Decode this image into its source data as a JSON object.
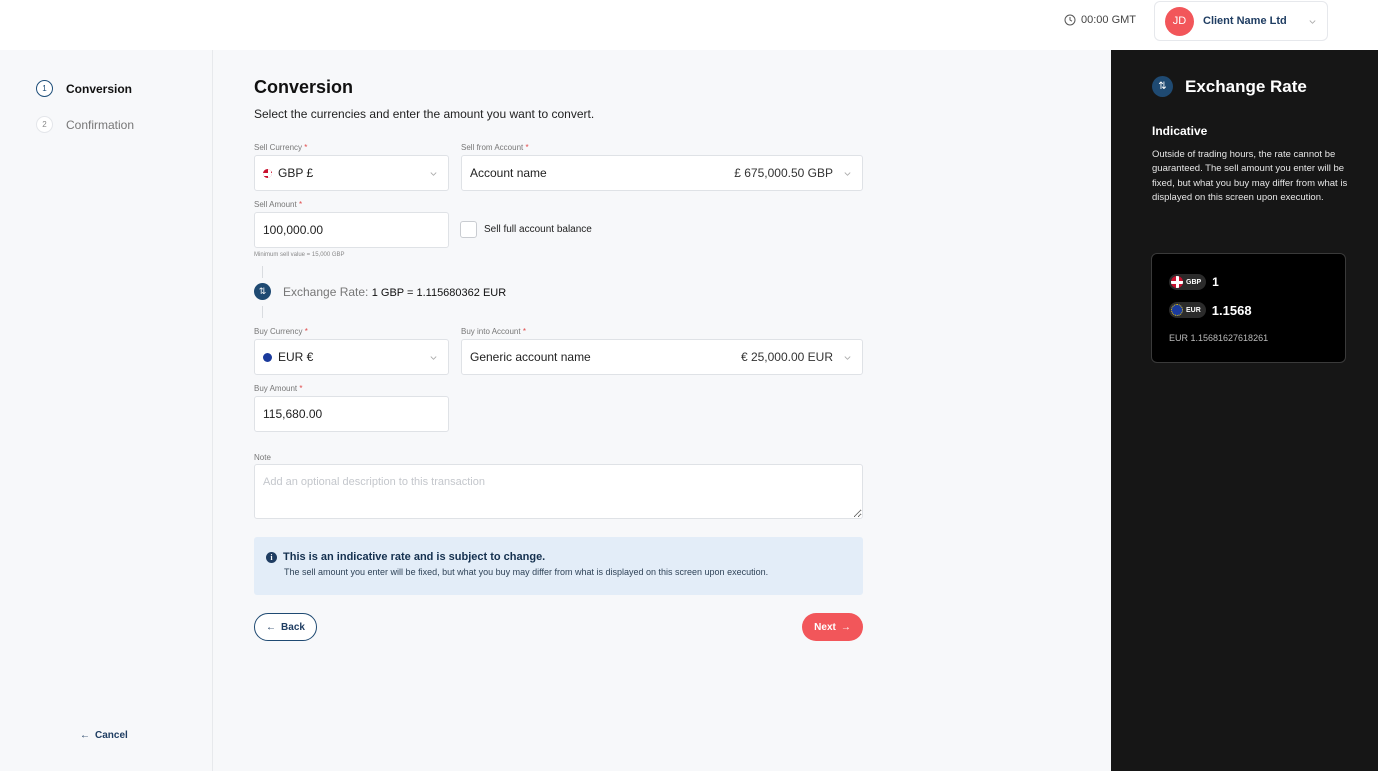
{
  "header": {
    "clock_icon": "clock-icon",
    "time": "00:00 GMT",
    "client": {
      "initials": "JD",
      "name": "Client Name Ltd",
      "avatar_color": "#f2565a"
    }
  },
  "steps": [
    {
      "number": "1",
      "label": "Conversion",
      "active": true
    },
    {
      "number": "2",
      "label": "Confirmation",
      "active": false
    }
  ],
  "cancel_label": "Cancel",
  "form": {
    "title": "Conversion",
    "subtitle": "Select the currencies and enter the amount you want to convert.",
    "sell_currency": {
      "label": "Sell Currency",
      "value": "GBP £"
    },
    "sell_account": {
      "label": "Sell from Account",
      "name": "Account name",
      "balance": "£ 675,000.50 GBP"
    },
    "sell_amount": {
      "label": "Sell Amount",
      "value": "100,000.00",
      "hint": "Minimum sell value = 15,000 GBP"
    },
    "sell_full_balance": {
      "label": "Sell full account balance",
      "checked": false
    },
    "exchange_rate": {
      "label": "Exchange Rate:",
      "value": "1 GBP = 1.115680362 EUR"
    },
    "buy_currency": {
      "label": "Buy Currency",
      "value": "EUR €"
    },
    "buy_account": {
      "label": "Buy into Account",
      "name": "Generic account name",
      "balance": "€ 25,000.00 EUR"
    },
    "buy_amount": {
      "label": "Buy Amount",
      "value": "115,680.00"
    },
    "note": {
      "label": "Note",
      "placeholder": "Add an optional description to this transaction"
    },
    "required_mark": "*",
    "info": {
      "title": "This is an indicative rate and is subject to change.",
      "body": "The sell amount you enter will be fixed, but what you buy may differ from what is displayed on this screen upon execution."
    },
    "back_label": "Back",
    "next_label": "Next",
    "accent_color": "#f2565a",
    "brand_color": "#1f3d62"
  },
  "panel": {
    "title": "Exchange Rate",
    "subtitle": "Indicative",
    "text": "Outside of trading hours, the rate cannot be guaranteed. The sell amount you enter will be fixed, but what you buy may differ from what is displayed on this screen upon execution.",
    "sell": {
      "code": "GBP",
      "value": "1"
    },
    "buy": {
      "code": "EUR",
      "value": "1.1568"
    },
    "full_rate": "EUR 1.15681627618261"
  }
}
